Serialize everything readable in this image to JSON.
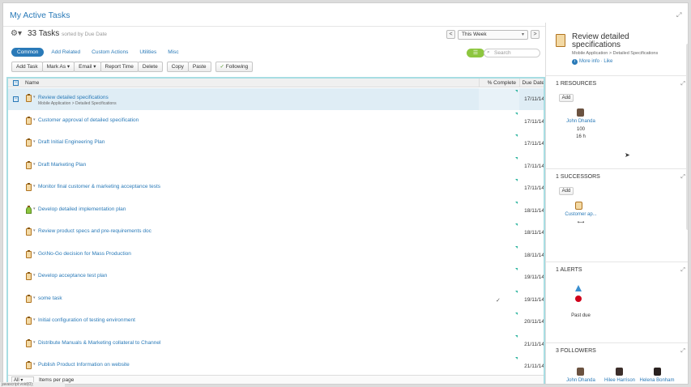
{
  "page": {
    "title": "My Active Tasks"
  },
  "header": {
    "count": "33 Tasks",
    "sorted": "sorted by Due Date",
    "week": "This Week",
    "prev": "<",
    "next": ">"
  },
  "tabs": [
    {
      "label": "Common"
    },
    {
      "label": "Add Related"
    },
    {
      "label": "Custom Actions"
    },
    {
      "label": "Utilities"
    },
    {
      "label": "Misc"
    }
  ],
  "search": {
    "placeholder": "Search"
  },
  "toolbar": {
    "add_task": "Add Task",
    "mark_as": "Mark As ▾",
    "email": "Email ▾",
    "report_time": "Report Time",
    "delete": "Delete",
    "copy": "Copy",
    "paste": "Paste",
    "following": "Following"
  },
  "grid": {
    "headers": {
      "name": "Name",
      "pct": "% Complete",
      "due": "Due Date"
    },
    "rows": [
      {
        "name": "Review detailed specifications",
        "sub": "Mobile Application > Detailed Specifications",
        "due": "17/11/14",
        "icon": "clipboard",
        "selected": true
      },
      {
        "name": "Customer approval of detailed specification",
        "due": "17/11/14",
        "icon": "clipboard"
      },
      {
        "name": "Draft Initial Engineering Plan",
        "due": "17/11/14",
        "icon": "clipboard"
      },
      {
        "name": "Draft Marketing Plan",
        "due": "17/11/14",
        "icon": "clipboard"
      },
      {
        "name": "Monitor final customer & marketing acceptance tests",
        "due": "17/11/14",
        "icon": "clipboard"
      },
      {
        "name": "Develop detailed implementation plan",
        "due": "18/11/14",
        "icon": "milestone"
      },
      {
        "name": "Review product specs and pre-requirements doc",
        "due": "18/11/14",
        "icon": "clipboard"
      },
      {
        "name": "Go\\No-Go decision for Mass Production",
        "due": "18/11/14",
        "icon": "clipboard"
      },
      {
        "name": "Develop acceptance test plan",
        "due": "19/11/14",
        "icon": "clipboard"
      },
      {
        "name": "some task",
        "due": "19/11/14",
        "icon": "clipboard",
        "check": true
      },
      {
        "name": "Initial configuration of testing environment",
        "due": "20/11/14",
        "icon": "clipboard"
      },
      {
        "name": "Distribute Manuals & Marketing collateral to Channel",
        "due": "21/11/14",
        "icon": "clipboard"
      },
      {
        "name": "Publish Product Information on website",
        "due": "21/11/14",
        "icon": "clipboard"
      }
    ],
    "footer": {
      "per_page_value": "All",
      "per_page_label": "Items per page"
    }
  },
  "status_bar": "javascript:void(0);",
  "detail": {
    "title": "Review detailed specifications",
    "path": "Mobile Application > Detailed Specifications",
    "more_info": "More info",
    "like": "Like",
    "resources": {
      "header": "1 RESOURCES",
      "add": "Add",
      "name": "John Dhanda",
      "units": "100",
      "hours": "16 h"
    },
    "successors": {
      "header": "1 SUCCESSORS",
      "add": "Add",
      "name": "Customer ap...",
      "link": "⟷"
    },
    "alerts": {
      "header": "1 ALERTS",
      "label": "Past due"
    },
    "followers": {
      "header": "3 FOLLOWERS",
      "people": [
        "John Dhanda",
        "Hilee Harrison",
        "Helena Bonham"
      ]
    }
  }
}
